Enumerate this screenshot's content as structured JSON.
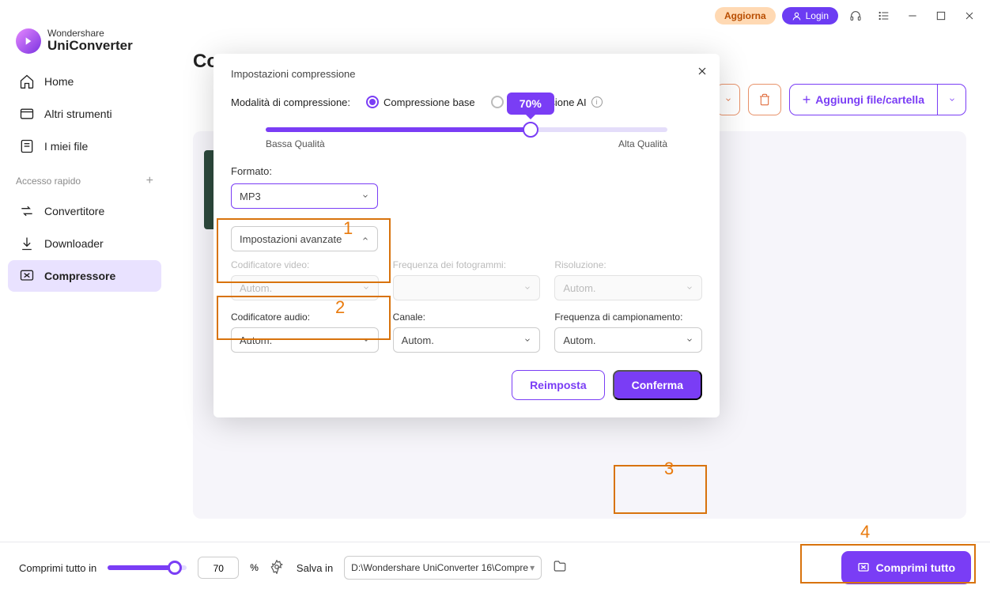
{
  "titlebar": {
    "upgrade": "Aggiorna",
    "login": "Login"
  },
  "logo": {
    "top": "Wondershare",
    "bottom": "UniConverter"
  },
  "nav": {
    "home": "Home",
    "tools": "Altri strumenti",
    "myfiles": "I miei file",
    "quick_access": "Accesso rapido",
    "converter": "Convertitore",
    "downloader": "Downloader",
    "compressor": "Compressore"
  },
  "page": {
    "title": "Compressore",
    "add_btn": "Aggiungi file/cartella"
  },
  "bottom": {
    "compress_in": "Comprimi tutto in",
    "percent": "70",
    "percent_sym": "%",
    "save_in": "Salva in",
    "save_path": "D:\\Wondershare UniConverter 16\\Compre",
    "compress_all": "Comprimi tutto"
  },
  "modal": {
    "title": "Impostazioni compressione",
    "mode_label": "Modalità di compressione:",
    "mode_basic": "Compressione base",
    "mode_ai": "Compressione AI",
    "slider_value": "70%",
    "low_q": "Bassa Qualità",
    "high_q": "Alta Qualità",
    "format_label": "Formato:",
    "format_value": "MP3",
    "advanced_label": "Impostazioni avanzate",
    "video_enc": "Codificatore video:",
    "framerate": "Frequenza dei fotogrammi:",
    "resolution": "Risoluzione:",
    "audio_enc": "Codificatore audio:",
    "channel": "Canale:",
    "samplerate": "Frequenza di campionamento:",
    "auto": "Autom.",
    "reset": "Reimposta",
    "confirm": "Conferma"
  },
  "annotations": {
    "a1": "1",
    "a2": "2",
    "a3": "3",
    "a4": "4"
  }
}
